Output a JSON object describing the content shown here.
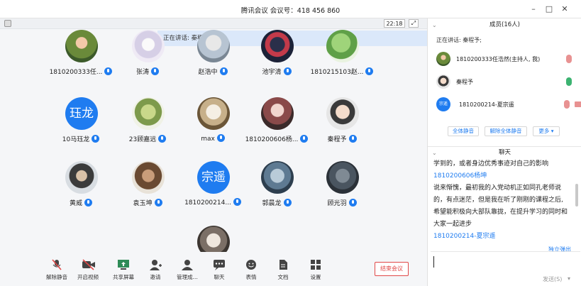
{
  "window": {
    "title": "腾讯会议  会议号：418 456 860",
    "controls": {
      "minimize": "–",
      "maximize": "□",
      "close": "✕"
    }
  },
  "main": {
    "clock": "22:18",
    "speaking_banner": "正在讲话: 秦程予;",
    "participants": [
      {
        "name": "1810200333任...",
        "avatar": "photo"
      },
      {
        "name": "张涛",
        "avatar": "photo"
      },
      {
        "name": "赵浩中",
        "avatar": "photo"
      },
      {
        "name": "池宇清",
        "avatar": "photo"
      },
      {
        "name": "1810215103赵...",
        "avatar": "photo"
      },
      {
        "name": "10马珏龙",
        "avatar": "text",
        "avatar_text": "珏龙"
      },
      {
        "name": "23顾嘉远",
        "avatar": "photo"
      },
      {
        "name": "max",
        "avatar": "photo"
      },
      {
        "name": "1810200606杨...",
        "avatar": "photo"
      },
      {
        "name": "秦程予",
        "avatar": "photo"
      },
      {
        "name": "黄威",
        "avatar": "photo"
      },
      {
        "name": "袁玉坤",
        "avatar": "photo"
      },
      {
        "name": "1810200214...",
        "avatar": "text",
        "avatar_text": "宗遥"
      },
      {
        "name": "郭晨龙",
        "avatar": "photo"
      },
      {
        "name": "顾光羽",
        "avatar": "photo"
      },
      {
        "name": "",
        "avatar": "photo"
      }
    ]
  },
  "toolbar": {
    "items": [
      {
        "label": "解除静音",
        "icon": "mic-muted-icon"
      },
      {
        "label": "开启视频",
        "icon": "camera-off-icon"
      },
      {
        "label": "共享屏幕",
        "icon": "share-screen-icon"
      },
      {
        "label": "邀请",
        "icon": "invite-icon"
      },
      {
        "label": "管理成...",
        "icon": "members-icon"
      },
      {
        "label": "聊天",
        "icon": "chat-icon"
      },
      {
        "label": "表情",
        "icon": "emoji-icon"
      },
      {
        "label": "文档",
        "icon": "document-icon"
      },
      {
        "label": "设置",
        "icon": "settings-icon"
      }
    ],
    "end_label": "结束会议"
  },
  "panel": {
    "members_title": "成员(16人)",
    "speaking": "正在讲话: 秦程予;",
    "members": [
      {
        "name": "1810200333任浩然(主持人, 我)",
        "avatar": "photo",
        "mic": "off"
      },
      {
        "name": "秦程予",
        "avatar": "photo",
        "mic": "on"
      },
      {
        "name": "1810200214-夏宗遥",
        "avatar": "text",
        "avatar_text": "宗遥",
        "mic": "off",
        "cam": "off"
      }
    ],
    "buttons": {
      "mute_all": "全体静音",
      "unmute_all": "解除全体静音",
      "more": "更多 ▾"
    },
    "chat_title": "聊天",
    "chat_lines": [
      {
        "type": "text",
        "text": "学到的，或者身边优秀事迹对自己的影响"
      },
      {
        "type": "sender",
        "text": "1810200606杨坤"
      },
      {
        "type": "text",
        "text": "说来惭愧，最初我的入党动机正如同孔老师说"
      },
      {
        "type": "text",
        "text": "的，有点迷茫，但是我在听了刚刚的课程之后,"
      },
      {
        "type": "text",
        "text": "希望能积极向大部队靠拢，在提升学习的同时和"
      },
      {
        "type": "text",
        "text": "大家一起进步"
      },
      {
        "type": "sender",
        "text": "1810200214-夏宗遥"
      }
    ],
    "float_link": "独立弹出",
    "send_label": "发送(S)",
    "send_chevron": "▾"
  }
}
